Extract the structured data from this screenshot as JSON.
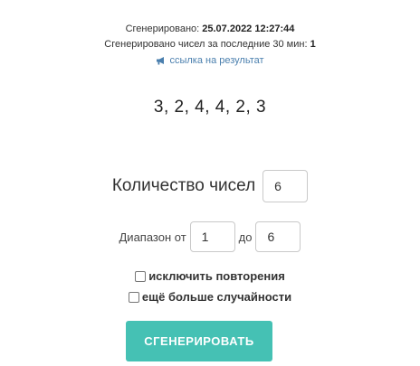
{
  "meta": {
    "generated_label": "Сгенерировано:",
    "generated_value": "25.07.2022 12:27:44",
    "count_label": "Сгенерировано чисел за последние 30 мин:",
    "count_value": "1",
    "link_icon": "megaphone-icon",
    "link_text": "ссылка на результат",
    "link_color": "#4a7fae"
  },
  "result": {
    "numbers": "3, 2, 4, 4, 2, 3"
  },
  "form": {
    "count_label": "Количество чисел",
    "count_value": "6",
    "range_label": "Диапазон от",
    "range_from": "1",
    "range_to_label": "до",
    "range_to": "6",
    "no_repeat_label": "исключить повторения",
    "no_repeat_checked": false,
    "more_random_label": "ещё больше случайности",
    "more_random_checked": false,
    "button_label": "СГЕНЕРИРОВАТЬ",
    "button_color": "#45c1b4"
  }
}
